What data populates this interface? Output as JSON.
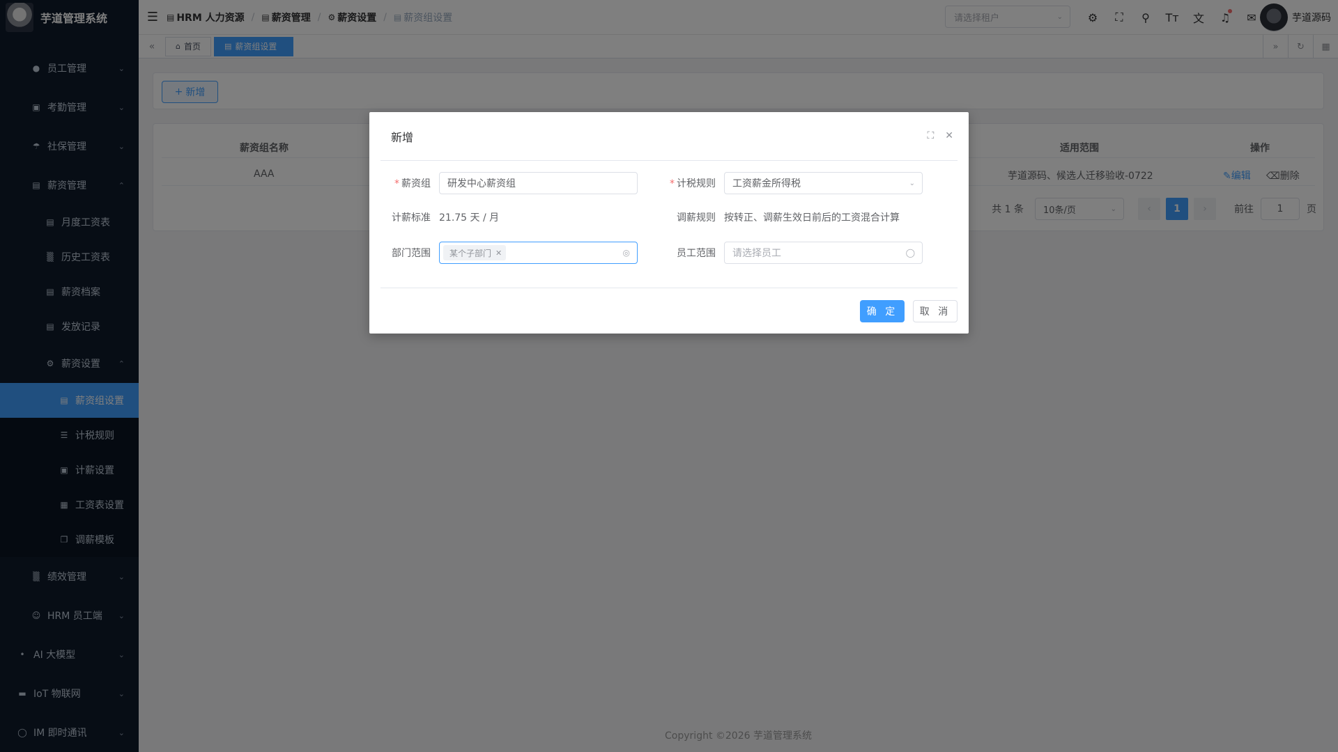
{
  "app": {
    "title": "芋道管理系统"
  },
  "sidebar": {
    "items": [
      {
        "label": "员工管理",
        "icon": "user-icon"
      },
      {
        "label": "考勤管理",
        "icon": "calendar-icon"
      },
      {
        "label": "社保管理",
        "icon": "umbrella-icon"
      },
      {
        "label": "薪资管理",
        "icon": "salary-icon"
      },
      {
        "label": "绩效管理",
        "icon": "bar-chart-icon"
      },
      {
        "label": "HRM 员工端",
        "icon": "user-icon"
      },
      {
        "label": "AI 大模型",
        "icon": "ai-icon"
      },
      {
        "label": "IoT 物联网",
        "icon": "iot-icon"
      },
      {
        "label": "IM 即时通讯",
        "icon": "chat-icon"
      }
    ],
    "salary_sub": [
      {
        "label": "月度工资表",
        "icon": "doc-icon"
      },
      {
        "label": "历史工资表",
        "icon": "bar-chart-icon"
      },
      {
        "label": "薪资档案",
        "icon": "archive-icon"
      },
      {
        "label": "发放记录",
        "icon": "doc-icon"
      }
    ],
    "salary_settings": {
      "label": "薪资设置",
      "icon": "gear-icon"
    },
    "settings_sub": [
      {
        "label": "薪资组设置",
        "icon": "building-icon"
      },
      {
        "label": "计税规则",
        "icon": "database-icon"
      },
      {
        "label": "计薪设置",
        "icon": "calendar-icon"
      },
      {
        "label": "工资表设置",
        "icon": "grid-icon"
      },
      {
        "label": "调薪模板",
        "icon": "copy-icon"
      }
    ]
  },
  "topbar": {
    "breadcrumb": [
      "HRM 人力资源",
      "薪资管理",
      "薪资设置",
      "薪资组设置"
    ],
    "tenant_placeholder": "请选择租户",
    "icons": [
      "gear-icon",
      "fullscreen-icon",
      "search-icon",
      "font-size-icon",
      "translate-icon",
      "bell-icon",
      "message-icon"
    ],
    "username": "芋道源码"
  },
  "tags": {
    "home": "首页",
    "current": "薪资组设置"
  },
  "main": {
    "add_button": "新增",
    "table": {
      "headers": [
        "薪资组名称",
        "适用范围",
        "操作"
      ],
      "rows": [
        {
          "name": "AAA",
          "scope": "芋道源码、候选人迁移验收-0722",
          "edit": "编辑",
          "delete": "删除"
        }
      ]
    },
    "pager": {
      "total": "共 1 条",
      "size": "10条/页",
      "current": "1",
      "goto_label": "前往",
      "goto_value": "1",
      "page_suffix": "页"
    }
  },
  "footer": "Copyright ©2026 芋道管理系统",
  "dialog": {
    "title": "新增",
    "salary_group_label": "薪资组",
    "salary_group_value": "研发中心薪资组",
    "tax_rule_label": "计税规则",
    "tax_rule_value": "工资薪金所得税",
    "pay_standard_label": "计薪标准",
    "pay_standard_value": "21.75 天 / 月",
    "adjust_rule_label": "调薪规则",
    "adjust_rule_value": "按转正、调薪生效日前后的工资混合计算",
    "dept_label": "部门范围",
    "dept_chip": "某个子部门",
    "emp_label": "员工范围",
    "emp_placeholder": "请选择员工",
    "ok": "确 定",
    "cancel": "取 消"
  }
}
